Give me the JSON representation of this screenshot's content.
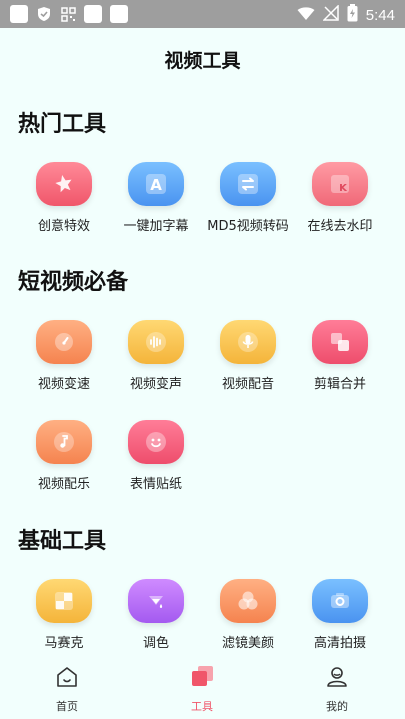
{
  "status_bar": {
    "time": "5:44"
  },
  "page": {
    "title": "视频工具"
  },
  "sections": {
    "hot": {
      "title": "热门工具",
      "items": [
        {
          "label": "创意特效",
          "icon": "star-icon",
          "color": "#f0566a"
        },
        {
          "label": "一键加字幕",
          "icon": "letter-a-icon",
          "color": "#4a93f0"
        },
        {
          "label": "MD5视频转码",
          "icon": "convert-arrows-icon",
          "color": "#4a93f0"
        },
        {
          "label": "在线去水印",
          "icon": "letter-k-icon",
          "color": "#f06878"
        }
      ]
    },
    "short_video": {
      "title": "短视频必备",
      "items": [
        {
          "label": "视频变速",
          "icon": "speedometer-icon",
          "color": "#f5834f"
        },
        {
          "label": "视频变声",
          "icon": "sound-wave-icon",
          "color": "#f4b43a"
        },
        {
          "label": "视频配音",
          "icon": "microphone-icon",
          "color": "#f4b43a"
        },
        {
          "label": "剪辑合并",
          "icon": "merge-squares-icon",
          "color": "#ee4d6c"
        },
        {
          "label": "视频配乐",
          "icon": "music-note-icon",
          "color": "#f5834f"
        },
        {
          "label": "表情贴纸",
          "icon": "smiley-icon",
          "color": "#ee4d6c"
        }
      ]
    },
    "basic": {
      "title": "基础工具",
      "items": [
        {
          "label": "马赛克",
          "icon": "mosaic-icon",
          "color": "#f4b43a"
        },
        {
          "label": "调色",
          "icon": "paint-bucket-icon",
          "color": "#a45af0"
        },
        {
          "label": "滤镜美颜",
          "icon": "filter-circles-icon",
          "color": "#f5834f"
        },
        {
          "label": "高清拍摄",
          "icon": "camera-icon",
          "color": "#4a93f0"
        }
      ]
    }
  },
  "bottom_nav": {
    "home": "首页",
    "tools": "工具",
    "mine": "我的",
    "active": "tools",
    "active_color": "#f0566a"
  }
}
